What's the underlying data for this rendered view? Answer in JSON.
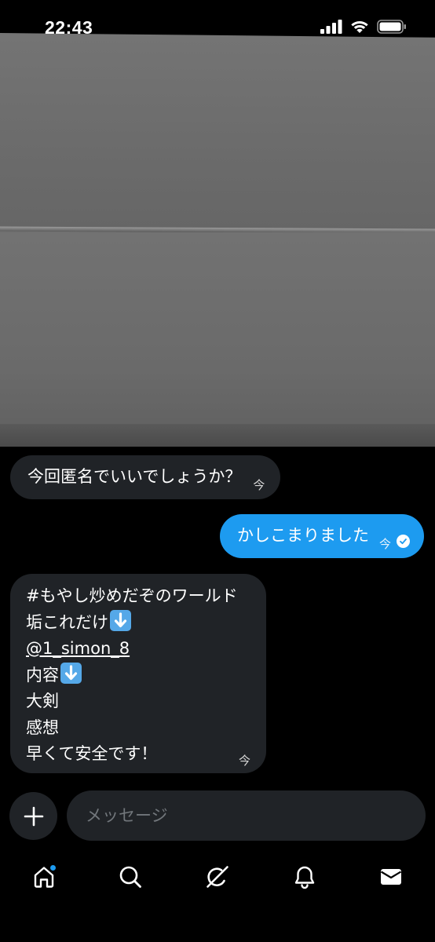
{
  "status_bar": {
    "time": "22:43"
  },
  "messages": [
    {
      "direction": "in",
      "text": "今回匿名でいいでしょうか？",
      "timestamp": "今"
    },
    {
      "direction": "out",
      "text": "かしこまりました",
      "timestamp": "今",
      "read": true
    },
    {
      "direction": "in",
      "lines": [
        "#もやし炒めだぞのワールド",
        "垢これだけ",
        "@1_simon_8",
        "内容",
        "大剣",
        "感想",
        "早くて安全です！"
      ],
      "timestamp": "今"
    }
  ],
  "composer": {
    "placeholder": "メッセージ"
  },
  "icons": {
    "attach": "plus-icon",
    "home": "home-icon",
    "search": "search-icon",
    "grok": "grok-icon",
    "notifications": "bell-icon",
    "messages": "envelope-icon",
    "down_arrow_emoji": "down-arrow-emoji-icon"
  },
  "colors": {
    "accent": "#1d9bf0",
    "bubble_in": "#202327",
    "background": "#000000"
  }
}
